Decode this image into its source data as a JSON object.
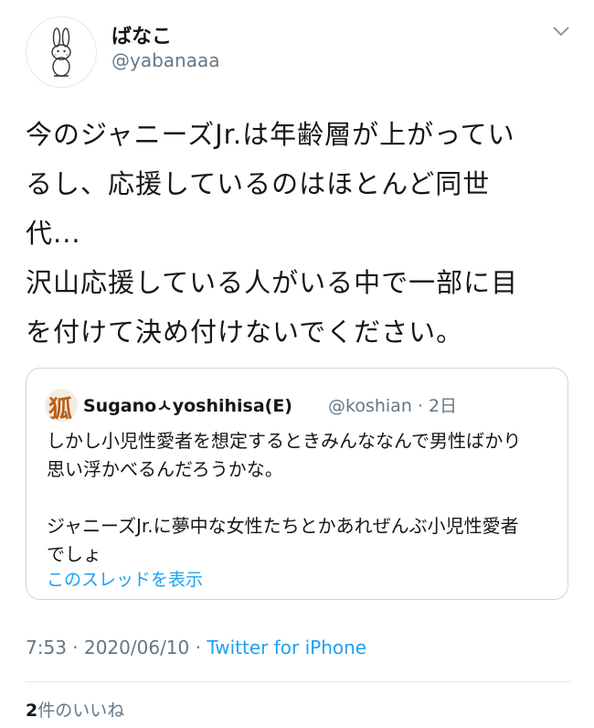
{
  "author": {
    "display_name": "ばなこ",
    "handle": "@yabanaaa"
  },
  "tweet": {
    "text": "今のジャニーズJr.は年齢層が上がってい\nるし、応援しているのはほとんど同世\n代...\n沢山応援している人がいる中で一部に目\nを付けて決め付けないでください。"
  },
  "quoted_tweet": {
    "avatar_glyph": "狐",
    "display_name": "Suganoㅅyoshihisa(E)",
    "handle_time": "@koshian · 2日",
    "text": "しかし小児性愛者を想定するときみんななんで男性ばかり\n思い浮かべるんだろうかな。\n\nジャニーズJr.に夢中な女性たちとかあれぜんぶ小児性愛者\nでしょ",
    "thread_link": "このスレッドを表示"
  },
  "meta": {
    "timestamp": "7:53 · 2020/06/10 · ",
    "source": "Twitter for iPhone"
  },
  "likes": {
    "count": "2",
    "label": "件のいいね"
  },
  "icons": [
    "avatar-rabbit-icon",
    "chevron-down-icon",
    "fox-avatar-icon"
  ],
  "colors": {
    "accent": "#1da1f2",
    "muted": "#657786",
    "border": "#ccd6dd"
  }
}
